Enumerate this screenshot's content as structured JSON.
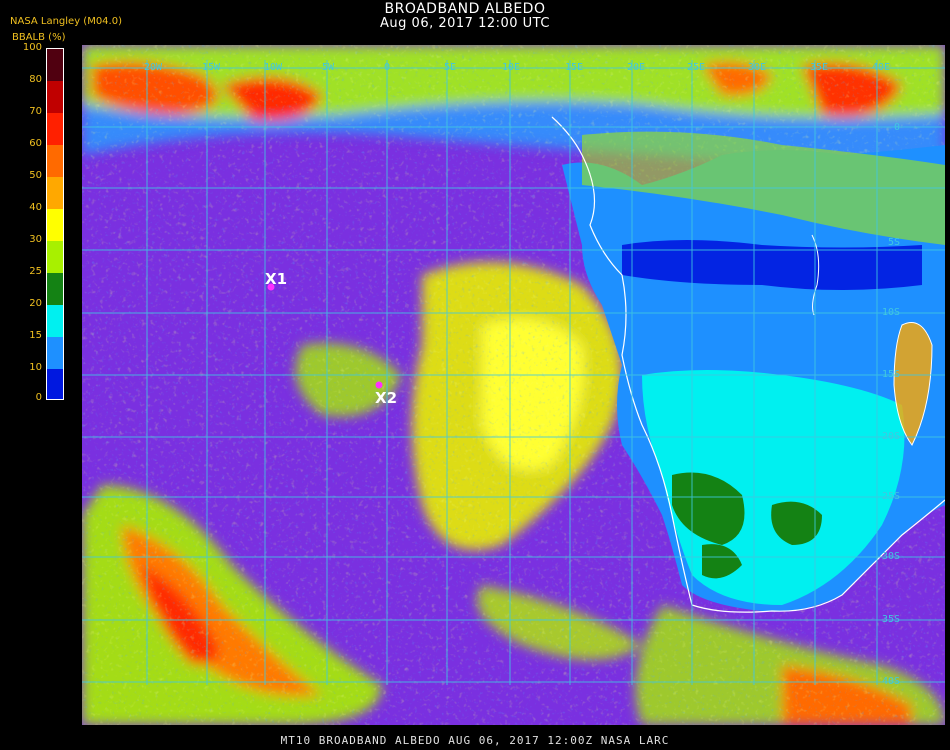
{
  "header": {
    "title": "BROADBAND ALBEDO",
    "datetime": "Aug 06, 2017 12:00 UTC",
    "credit": "NASA Langley (M04.0)",
    "unit": "BBALB (%)"
  },
  "colorbar": {
    "labels": [
      "100",
      "80",
      "70",
      "60",
      "50",
      "40",
      "30",
      "25",
      "20",
      "15",
      "10",
      "0"
    ],
    "colors": [
      "#500010",
      "#c00000",
      "#ff2000",
      "#ff6a00",
      "#ffa800",
      "#ffff00",
      "#a8f000",
      "#148214",
      "#00f0f0",
      "#1e90ff",
      "#0018e0",
      "#7a30e0"
    ]
  },
  "map": {
    "lon_labels": [
      "20W",
      "15W",
      "10W",
      "5W",
      "0",
      "5E",
      "10E",
      "15E",
      "20E",
      "25E",
      "30E",
      "35E",
      "40E"
    ],
    "lat_labels": [
      "0",
      "5S",
      "10S",
      "15S",
      "20S",
      "25S",
      "30S",
      "35S",
      "40S"
    ],
    "markers": [
      {
        "label": "X1",
        "lon": -16.2,
        "lat": -11.4
      },
      {
        "label": "X2",
        "lon": -7.4,
        "lat": -20.6
      }
    ],
    "gridline_color": "#40c8e0"
  },
  "footer": {
    "text": "MT10  BROADBAND ALBEDO   AUG 06, 2017 12:00Z   NASA LARC"
  }
}
